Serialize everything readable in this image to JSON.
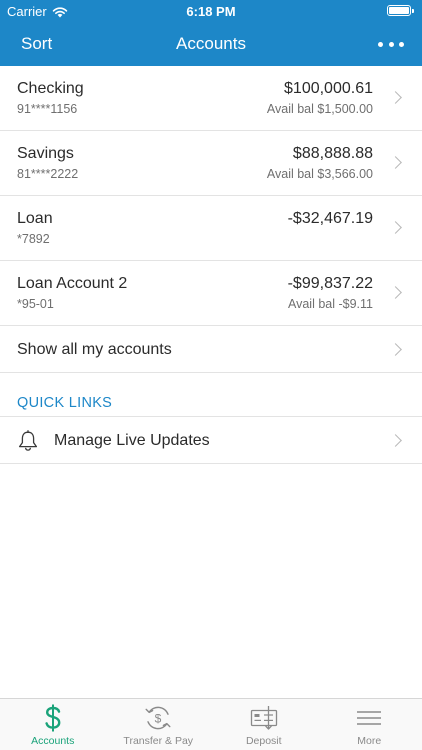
{
  "status_bar": {
    "carrier": "Carrier",
    "time": "6:18 PM"
  },
  "nav": {
    "left_button": "Sort",
    "title": "Accounts"
  },
  "accounts": [
    {
      "name": "Checking",
      "number": "91****1156",
      "balance": "$100,000.61",
      "available": "Avail bal $1,500.00"
    },
    {
      "name": "Savings",
      "number": "81****2222",
      "balance": "$88,888.88",
      "available": "Avail bal $3,566.00"
    },
    {
      "name": "Loan",
      "number": "*7892",
      "balance": "-$32,467.19",
      "available": ""
    },
    {
      "name": "Loan Account 2",
      "number": "*95-01",
      "balance": "-$99,837.22",
      "available": "Avail bal -$9.11"
    }
  ],
  "show_all_label": "Show all my accounts",
  "quick_links": {
    "title": "QUICK LINKS",
    "items": [
      {
        "label": "Manage Live Updates",
        "icon": "bell-icon"
      }
    ]
  },
  "tab_bar": {
    "tabs": [
      {
        "label": "Accounts",
        "icon": "dollar-icon",
        "active": true
      },
      {
        "label": "Transfer & Pay",
        "icon": "transfer-icon",
        "active": false
      },
      {
        "label": "Deposit",
        "icon": "check-deposit-icon",
        "active": false
      },
      {
        "label": "More",
        "icon": "menu-icon",
        "active": false
      }
    ]
  },
  "colors": {
    "header_blue": "#1d87c8",
    "active_green": "#1aa37a",
    "divider": "#e3e3e3"
  }
}
